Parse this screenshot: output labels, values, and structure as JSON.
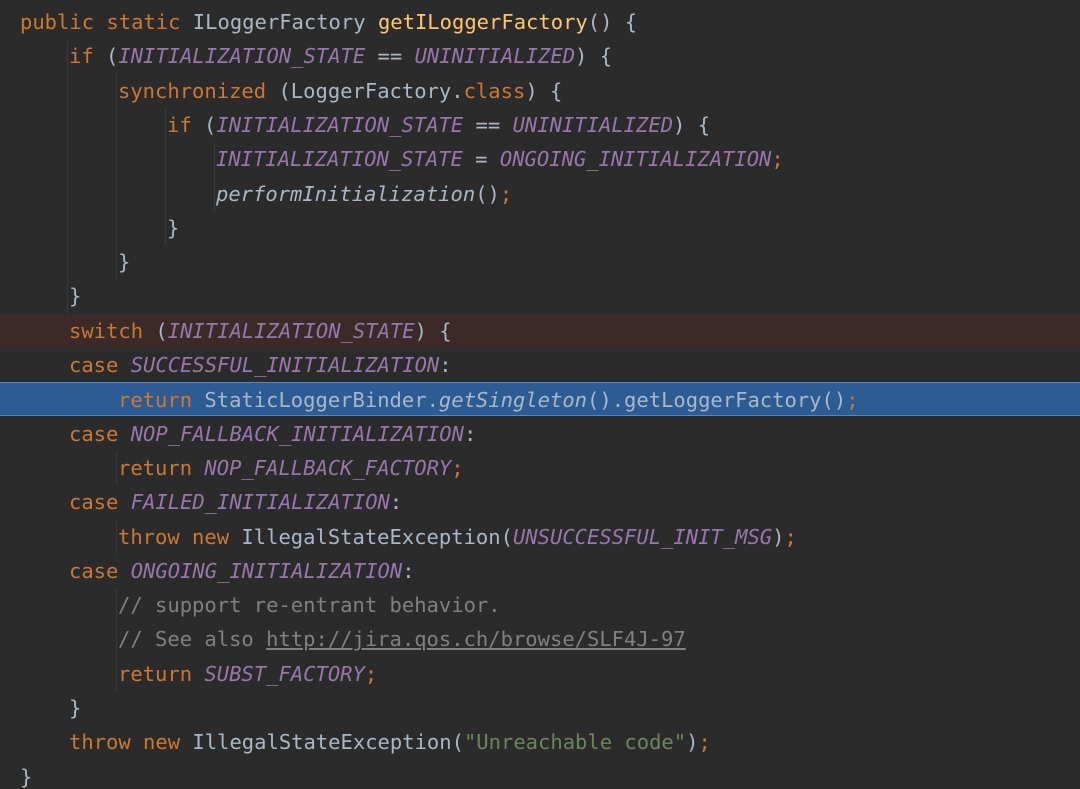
{
  "editor": {
    "lines": [
      [
        {
          "t": "public static ",
          "k": "kw"
        },
        {
          "t": "ILoggerFactory ",
          "k": "txt"
        },
        {
          "t": "getILoggerFactory",
          "k": "fn"
        },
        {
          "t": "() {",
          "k": "txt"
        }
      ],
      [
        {
          "t": "if ",
          "k": "kw"
        },
        {
          "t": "(",
          "k": "txt"
        },
        {
          "t": "INITIALIZATION_STATE",
          "k": "cst"
        },
        {
          "t": " == ",
          "k": "txt"
        },
        {
          "t": "UNINITIALIZED",
          "k": "cst"
        },
        {
          "t": ") {",
          "k": "txt"
        }
      ],
      [
        {
          "t": "synchronized ",
          "k": "kw"
        },
        {
          "t": "(LoggerFactory.",
          "k": "txt"
        },
        {
          "t": "class",
          "k": "kw"
        },
        {
          "t": ") {",
          "k": "txt"
        }
      ],
      [
        {
          "t": "if ",
          "k": "kw"
        },
        {
          "t": "(",
          "k": "txt"
        },
        {
          "t": "INITIALIZATION_STATE",
          "k": "cst"
        },
        {
          "t": " == ",
          "k": "txt"
        },
        {
          "t": "UNINITIALIZED",
          "k": "cst"
        },
        {
          "t": ") {",
          "k": "txt"
        }
      ],
      [
        {
          "t": "INITIALIZATION_STATE",
          "k": "cst"
        },
        {
          "t": " = ",
          "k": "txt"
        },
        {
          "t": "ONGOING_INITIALIZATION",
          "k": "cst"
        },
        {
          "t": ";",
          "k": "kw"
        }
      ],
      [
        {
          "t": "performInitialization",
          "k": "sfn"
        },
        {
          "t": "()",
          "k": "txt"
        },
        {
          "t": ";",
          "k": "kw"
        }
      ],
      [
        {
          "t": "}",
          "k": "txt"
        }
      ],
      [
        {
          "t": "}",
          "k": "txt"
        }
      ],
      [
        {
          "t": "}",
          "k": "txt"
        }
      ],
      [
        {
          "t": "switch ",
          "k": "kw"
        },
        {
          "t": "(",
          "k": "txt"
        },
        {
          "t": "INITIALIZATION_STATE",
          "k": "cst"
        },
        {
          "t": ") {",
          "k": "txt"
        }
      ],
      [
        {
          "t": "case ",
          "k": "kw"
        },
        {
          "t": "SUCCESSFUL_INITIALIZATION",
          "k": "cst"
        },
        {
          "t": ":",
          "k": "txt"
        }
      ],
      [
        {
          "t": "return ",
          "k": "kw"
        },
        {
          "t": "StaticLoggerBinder.",
          "k": "txt"
        },
        {
          "t": "getSingleton",
          "k": "sfn"
        },
        {
          "t": "().getLoggerFactory()",
          "k": "txt"
        },
        {
          "t": ";",
          "k": "kw"
        }
      ],
      [
        {
          "t": "case ",
          "k": "kw"
        },
        {
          "t": "NOP_FALLBACK_INITIALIZATION",
          "k": "cst"
        },
        {
          "t": ":",
          "k": "txt"
        }
      ],
      [
        {
          "t": "return ",
          "k": "kw"
        },
        {
          "t": "NOP_FALLBACK_FACTORY",
          "k": "cst"
        },
        {
          "t": ";",
          "k": "kw"
        }
      ],
      [
        {
          "t": "case ",
          "k": "kw"
        },
        {
          "t": "FAILED_INITIALIZATION",
          "k": "cst"
        },
        {
          "t": ":",
          "k": "txt"
        }
      ],
      [
        {
          "t": "throw new ",
          "k": "kw"
        },
        {
          "t": "IllegalStateException(",
          "k": "txt"
        },
        {
          "t": "UNSUCCESSFUL_INIT_MSG",
          "k": "cst"
        },
        {
          "t": ")",
          "k": "txt"
        },
        {
          "t": ";",
          "k": "kw"
        }
      ],
      [
        {
          "t": "case ",
          "k": "kw"
        },
        {
          "t": "ONGOING_INITIALIZATION",
          "k": "cst"
        },
        {
          "t": ":",
          "k": "txt"
        }
      ],
      [
        {
          "t": "// support re-entrant behavior.",
          "k": "cmt"
        }
      ],
      [
        {
          "t": "// See also ",
          "k": "cmt"
        },
        {
          "t": "http://jira.qos.ch/browse/SLF4J-97",
          "k": "lnk"
        }
      ],
      [
        {
          "t": "return ",
          "k": "kw"
        },
        {
          "t": "SUBST_FACTORY",
          "k": "cst"
        },
        {
          "t": ";",
          "k": "kw"
        }
      ],
      [
        {
          "t": "}",
          "k": "txt"
        }
      ],
      [
        {
          "t": "throw new ",
          "k": "kw"
        },
        {
          "t": "IllegalStateException(",
          "k": "txt"
        },
        {
          "t": "\"Unreachable code\"",
          "k": "str"
        },
        {
          "t": ")",
          "k": "txt"
        },
        {
          "t": ";",
          "k": "kw"
        }
      ],
      [
        {
          "t": "}",
          "k": "txt"
        }
      ]
    ],
    "indents": [
      0,
      1,
      2,
      3,
      4,
      4,
      3,
      2,
      1,
      1,
      1,
      2,
      1,
      2,
      1,
      2,
      1,
      2,
      2,
      2,
      1,
      1,
      0
    ],
    "highlights": {
      "9": "breakpoint",
      "11": "execution"
    },
    "colors": {
      "background": "#2b2b2b",
      "keyword": "#cc7832",
      "method_decl": "#ffc66d",
      "constant": "#9876aa",
      "string": "#6a8759",
      "comment": "#808080",
      "text": "#a9b7c6",
      "breakpoint_line": "#3b2a28",
      "execution_line": "#2d5c93"
    }
  }
}
